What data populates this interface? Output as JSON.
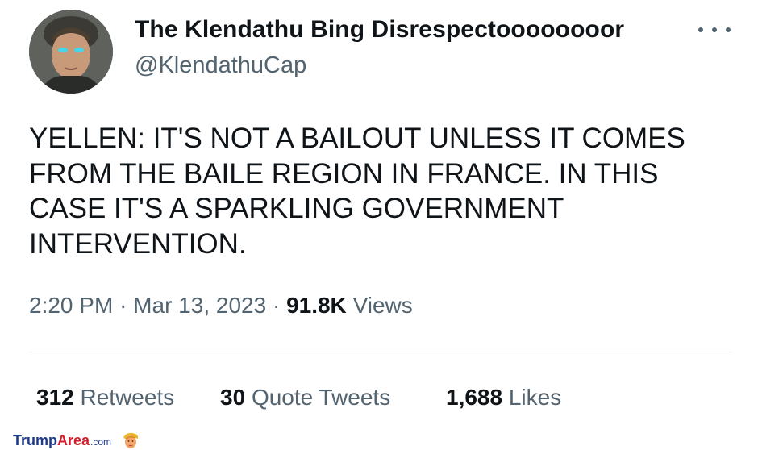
{
  "author": {
    "display_name": "The Klendathu Bing Disrespectoooooooor",
    "handle": "@KlendathuCap"
  },
  "tweet": {
    "text": "YELLEN: IT'S NOT A BAILOUT UNLESS IT COMES\nFROM THE BAILE REGION IN FRANCE. IN THIS\nCASE IT'S A SPARKLING GOVERNMENT\nINTERVENTION."
  },
  "meta": {
    "time": "2:20 PM",
    "date": "Mar 13, 2023",
    "separator": "·",
    "views_count": "91.8K",
    "views_label": "Views"
  },
  "stats": {
    "retweets_count": "312",
    "retweets_label": "Retweets",
    "quotes_count": "30",
    "quotes_label": "Quote Tweets",
    "likes_count": "1,688",
    "likes_label": "Likes"
  },
  "watermark": {
    "brand_part1": "Trump",
    "brand_part2": "Area",
    "brand_suffix": ".com"
  },
  "icons": {
    "more": "more-horizontal-icon",
    "logo": "trump-face-logo-icon"
  },
  "colors": {
    "text_primary": "#0f1419",
    "text_secondary": "#536471",
    "divider": "#e6e9eb",
    "watermark_blue": "#1f3a8a",
    "watermark_red": "#d21f2b"
  }
}
